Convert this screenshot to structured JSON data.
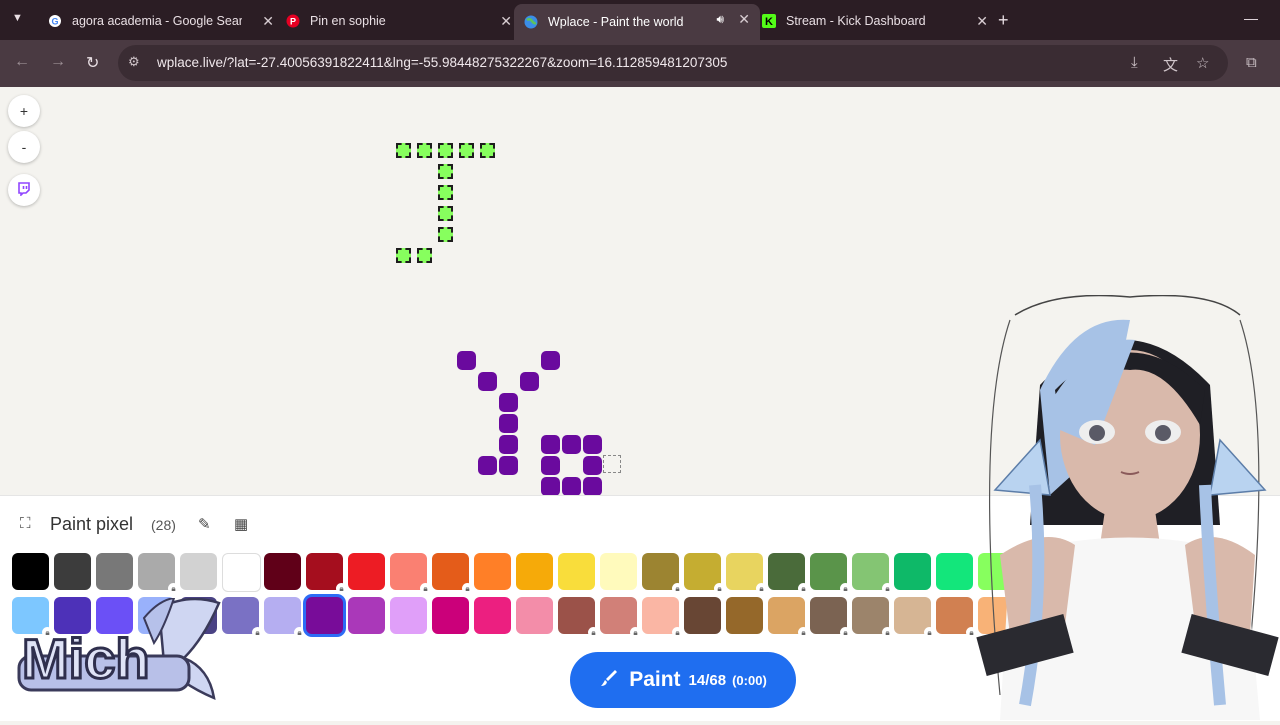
{
  "browser": {
    "tabs": [
      {
        "title": "agora academia - Google Search"
      },
      {
        "title": "Pin en sophie"
      },
      {
        "title": "Wplace - Paint the world"
      },
      {
        "title": "Stream - Kick Dashboard"
      }
    ],
    "url": "wplace.live/?lat=-27.40056391822411&lng=-55.98448275322267&zoom=16.112859481207305"
  },
  "map_controls": {
    "zoom_in": "+",
    "zoom_out": "-"
  },
  "panel": {
    "title": "Paint pixel",
    "count": "(28)"
  },
  "palette": {
    "row1": [
      {
        "color": "#000000",
        "locked": false
      },
      {
        "color": "#3c3c3c",
        "locked": false
      },
      {
        "color": "#787878",
        "locked": false
      },
      {
        "color": "#aaaaaa",
        "locked": true
      },
      {
        "color": "#d2d2d2",
        "locked": false
      },
      {
        "color": "#ffffff",
        "locked": false
      },
      {
        "color": "#600018",
        "locked": false
      },
      {
        "color": "#a50e1e",
        "locked": true
      },
      {
        "color": "#ed1c24",
        "locked": false
      },
      {
        "color": "#fa8072",
        "locked": true
      },
      {
        "color": "#e45c1a",
        "locked": true
      },
      {
        "color": "#ff7f27",
        "locked": false
      },
      {
        "color": "#f6aa09",
        "locked": false
      },
      {
        "color": "#f9dd3b",
        "locked": false
      },
      {
        "color": "#fffabc",
        "locked": false
      },
      {
        "color": "#9c8431",
        "locked": true
      },
      {
        "color": "#c5ad31",
        "locked": true
      },
      {
        "color": "#e8d45f",
        "locked": true
      },
      {
        "color": "#4a6b3a",
        "locked": true
      },
      {
        "color": "#5a944a",
        "locked": true
      },
      {
        "color": "#84c573",
        "locked": true
      },
      {
        "color": "#0eb968",
        "locked": false
      },
      {
        "color": "#13e67b",
        "locked": false
      },
      {
        "color": "#87ff5e",
        "locked": false
      }
    ],
    "row2": [
      {
        "color": "#7dc7ff",
        "locked": true
      },
      {
        "color": "#4d31b8",
        "locked": false
      },
      {
        "color": "#6b50f6",
        "locked": false
      },
      {
        "color": "#99b1fb",
        "locked": false
      },
      {
        "color": "#4a4284",
        "locked": false
      },
      {
        "color": "#7a71c4",
        "locked": true
      },
      {
        "color": "#b5aef1",
        "locked": true
      },
      {
        "color": "#780c99",
        "locked": false,
        "selected": true
      },
      {
        "color": "#aa38b9",
        "locked": false
      },
      {
        "color": "#e09ff9",
        "locked": false
      },
      {
        "color": "#cb007a",
        "locked": false
      },
      {
        "color": "#ec1f80",
        "locked": false
      },
      {
        "color": "#f38da9",
        "locked": false
      },
      {
        "color": "#9b5249",
        "locked": true
      },
      {
        "color": "#d18078",
        "locked": true
      },
      {
        "color": "#fab6a4",
        "locked": true
      },
      {
        "color": "#684634",
        "locked": false
      },
      {
        "color": "#95682a",
        "locked": false
      },
      {
        "color": "#dba463",
        "locked": true
      },
      {
        "color": "#7b6352",
        "locked": true
      },
      {
        "color": "#9c846b",
        "locked": true
      },
      {
        "color": "#d6b594",
        "locked": true
      },
      {
        "color": "#d18051",
        "locked": true
      },
      {
        "color": "#f8b277",
        "locked": true
      }
    ]
  },
  "paint_button": {
    "label": "Paint",
    "count": "14/68",
    "timer": "(0:00)"
  },
  "overlay": {
    "logo_text": "Mich"
  }
}
